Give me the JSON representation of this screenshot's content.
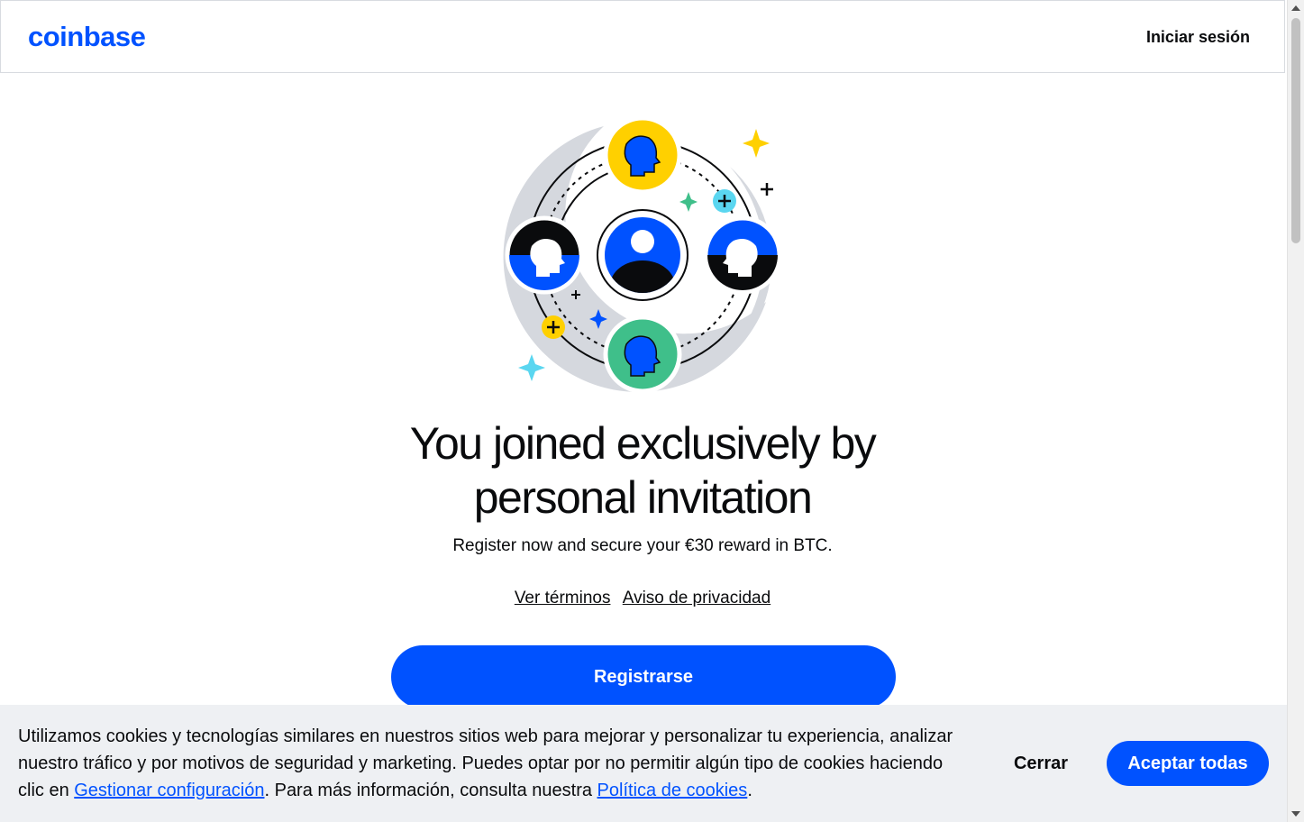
{
  "header": {
    "logo_text": "coinbase",
    "signin_label": "Iniciar sesión"
  },
  "hero": {
    "title_line1": "You joined exclusively by",
    "title_line2": "personal invitation",
    "subtitle": "Register now and secure your €30 reward in BTC.",
    "terms_link": "Ver términos",
    "privacy_link": "Aviso de privacidad",
    "register_label": "Registrarse"
  },
  "cookies": {
    "text_part1": "Utilizamos cookies y tecnologías similares en nuestros sitios web para mejorar y personalizar tu experiencia, analizar nuestro tráfico y por motivos de seguridad y marketing. Puedes optar por no permitir algún tipo de cookies haciendo clic en ",
    "manage_link": "Gestionar configuración",
    "text_part2": ". Para más información, consulta nuestra ",
    "policy_link": "Política de cookies",
    "text_part3": ".",
    "close_label": "Cerrar",
    "accept_label": "Aceptar todas"
  },
  "colors": {
    "brand_blue": "#0052ff",
    "banner_bg": "#eef0f3",
    "yellow": "#ffd000",
    "green": "#3fbf8a",
    "cyan": "#5ad6f0"
  },
  "icons": {
    "illustration": "community-network-illustration"
  }
}
